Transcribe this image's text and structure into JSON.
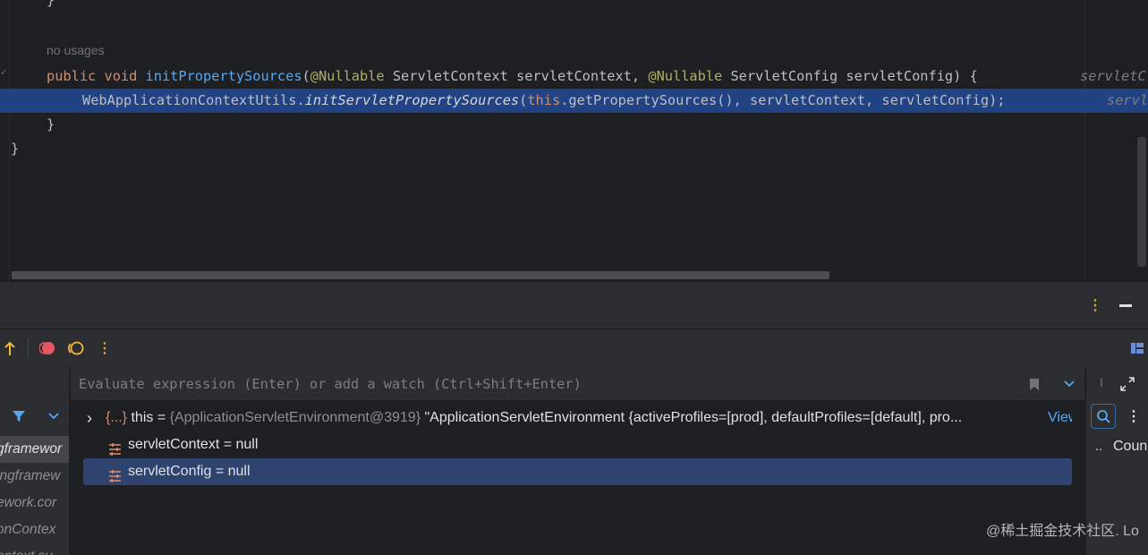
{
  "editor": {
    "top_brace": "}",
    "usages_hint": "no usages",
    "method_line": {
      "kw_public": "public",
      "kw_void": "void",
      "method_name": "initPropertySources",
      "open_paren": "(",
      "ann1": "@Nullable",
      "param1": " ServletContext servletContext, ",
      "ann2": "@Nullable",
      "param2": " ServletConfig servletConfig) {",
      "inlay_hint": "servletC"
    },
    "call_line": {
      "class_name": "WebApplicationContextUtils.",
      "static_method": "initServletPropertySources",
      "open_paren": "(",
      "kw_this": "this",
      "rest": ".getPropertySources(), servletContext, servletConfig);",
      "inlay_hint": "servl"
    },
    "method_close_brace": "}",
    "class_close_brace": "}"
  },
  "debug": {
    "header_more_icon": "more-vertical-icon",
    "header_minimize_icon": "minimize-icon",
    "toolbar": {
      "step_out_icon": "step-out-arrow-icon",
      "breakpoints_icon": "view-breakpoints-icon",
      "mute_icon": "mute-breakpoints-icon",
      "more_icon": "more-vertical-icon",
      "layout_icon": "layout-icon"
    },
    "frames": {
      "filter_icon": "filter-icon",
      "dropdown_icon": "chevron-down-icon",
      "items": [
        {
          "text": "gframewor"
        },
        {
          "text": "ingframew"
        },
        {
          "text": "ework.cor"
        },
        {
          "text": "onContex"
        },
        {
          "text": "ontext.su"
        }
      ]
    },
    "evaluate": {
      "placeholder": "Evaluate expression (Enter) or add a watch (Ctrl+Shift+Enter)",
      "bookmark_icon": "bookmark-icon",
      "history_icon": "chevron-down-icon"
    },
    "variables": [
      {
        "expand": "›",
        "icon": "{...}",
        "name": "this",
        "eq": " = ",
        "ref": "{ApplicationServletEnvironment@3919}",
        "value": " \"ApplicationServletEnvironment {activeProfiles=[prod], defaultProfiles=[default], pro...",
        "action": "View"
      },
      {
        "icon": "field-icon",
        "name": "servletContext",
        "eq": " = ",
        "value": "null"
      },
      {
        "icon": "field-icon",
        "name": "servletConfig",
        "eq": " = ",
        "value": "null"
      }
    ],
    "right_panel": {
      "tab_label": "I",
      "expand_icon": "expand-icon",
      "search_icon": "search-icon",
      "more_icon": "more-vertical-icon",
      "col_dots": "..",
      "col_header": "Coun"
    }
  },
  "watermark": "@稀土掘金技术社区. Lo"
}
